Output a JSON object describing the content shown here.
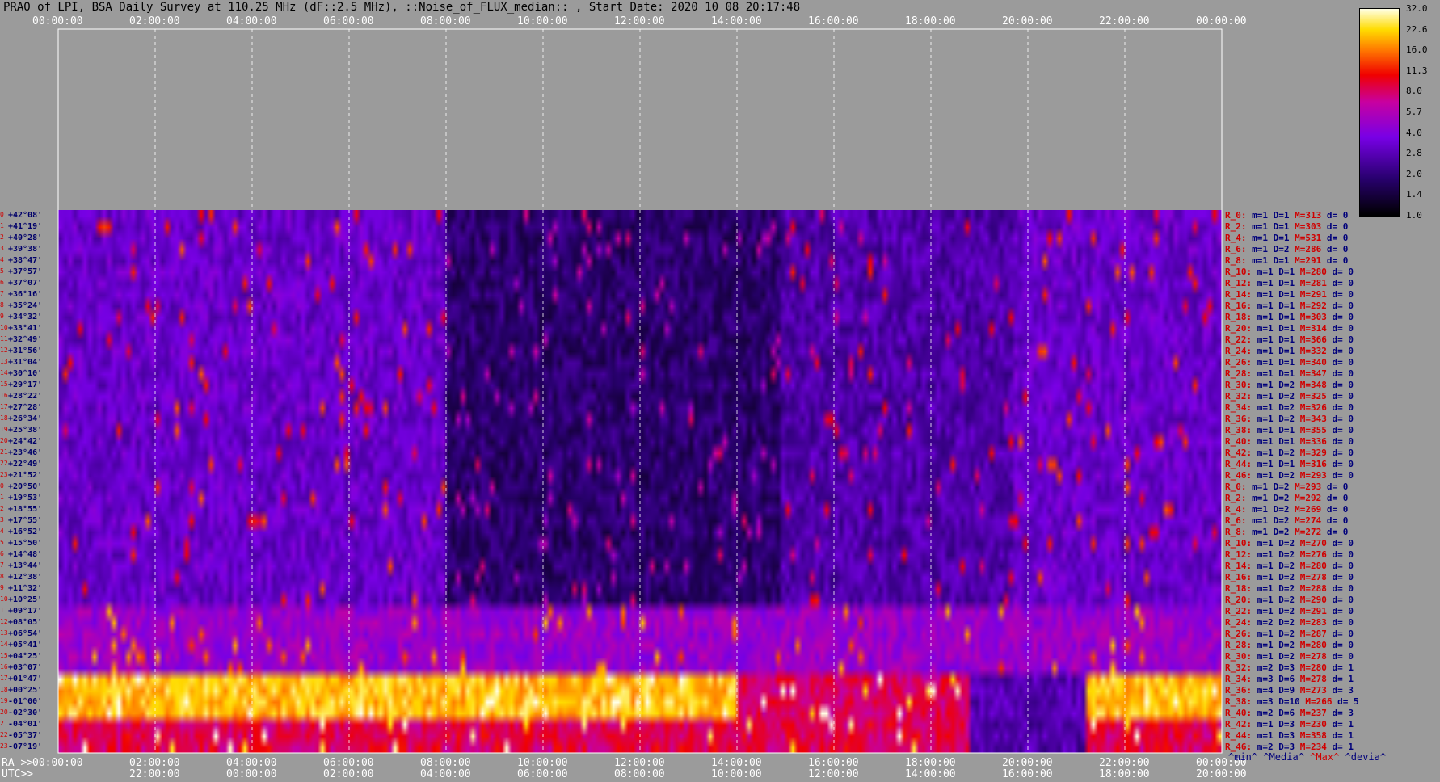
{
  "title": "PRAO of LPI, BSA Daily Survey at 110.25 MHz (dF::2.5 MHz), ::Noise_of_FLUX_median:: , Start Date: 2020 10 08 20:17:48",
  "chart_data": {
    "type": "heatmap",
    "x_top_ticks": [
      "00:00:00",
      "02:00:00",
      "04:00:00",
      "06:00:00",
      "08:00:00",
      "10:00:00",
      "12:00:00",
      "14:00:00",
      "16:00:00",
      "18:00:00",
      "20:00:00",
      "22:00:00",
      "00:00:00"
    ],
    "x_ra_ticks": [
      "00:00:00",
      "02:00:00",
      "04:00:00",
      "06:00:00",
      "08:00:00",
      "10:00:00",
      "12:00:00",
      "14:00:00",
      "16:00:00",
      "18:00:00",
      "20:00:00",
      "22:00:00",
      "00:00:00"
    ],
    "x_utc_ticks": [
      "22:00:00",
      "00:00:00",
      "02:00:00",
      "04:00:00",
      "06:00:00",
      "08:00:00",
      "10:00:00",
      "12:00:00",
      "14:00:00",
      "16:00:00",
      "18:00:00",
      "20:00:00"
    ],
    "ra_prefix": "RA >>",
    "utc_prefix": "UTC>>",
    "declinations": [
      "+42°08'",
      "+41°19'",
      "+40°28'",
      "+39°38'",
      "+38°47'",
      "+37°57'",
      "+37°07'",
      "+36°16'",
      "+35°24'",
      "+34°32'",
      "+33°41'",
      "+32°49'",
      "+31°56'",
      "+31°04'",
      "+30°10'",
      "+29°17'",
      "+28°22'",
      "+27°28'",
      "+26°34'",
      "+25°38'",
      "+24°42'",
      "+23°46'",
      "+22°49'",
      "+21°52'",
      "+20°50'",
      "+19°53'",
      "+18°55'",
      "+17°55'",
      "+16°52'",
      "+15°50'",
      "+14°48'",
      "+13°44'",
      "+12°38'",
      "+11°32'",
      "+10°25'",
      "+09°17'",
      "+08°05'",
      "+06°54'",
      "+05°41'",
      "+04°25'",
      "+03°07'",
      "+01°47'",
      "+00°25'",
      "-01°00'",
      "-02°30'",
      "-04°01'",
      "-05°37'",
      "-07°19'"
    ],
    "colorbar_ticks": [
      "32.0",
      "22.6",
      "16.0",
      "11.3",
      "8.0",
      "5.7",
      "4.0",
      "2.8",
      "2.0",
      "1.4",
      "1.0"
    ],
    "row_stats": [
      {
        "r": "R_0:",
        "m": "m=1",
        "D": "D=1",
        "M": "M=313",
        "d": "d= 0"
      },
      {
        "r": "R_2:",
        "m": "m=1",
        "D": "D=1",
        "M": "M=303",
        "d": "d= 0"
      },
      {
        "r": "R_4:",
        "m": "m=1",
        "D": "D=1",
        "M": "M=531",
        "d": "d= 0"
      },
      {
        "r": "R_6:",
        "m": "m=1",
        "D": "D=2",
        "M": "M=286",
        "d": "d= 0"
      },
      {
        "r": "R_8:",
        "m": "m=1",
        "D": "D=1",
        "M": "M=291",
        "d": "d= 0"
      },
      {
        "r": "R_10:",
        "m": "m=1",
        "D": "D=1",
        "M": "M=280",
        "d": "d= 0"
      },
      {
        "r": "R_12:",
        "m": "m=1",
        "D": "D=1",
        "M": "M=281",
        "d": "d= 0"
      },
      {
        "r": "R_14:",
        "m": "m=1",
        "D": "D=1",
        "M": "M=291",
        "d": "d= 0"
      },
      {
        "r": "R_16:",
        "m": "m=1",
        "D": "D=1",
        "M": "M=292",
        "d": "d= 0"
      },
      {
        "r": "R_18:",
        "m": "m=1",
        "D": "D=1",
        "M": "M=303",
        "d": "d= 0"
      },
      {
        "r": "R_20:",
        "m": "m=1",
        "D": "D=1",
        "M": "M=314",
        "d": "d= 0"
      },
      {
        "r": "R_22:",
        "m": "m=1",
        "D": "D=1",
        "M": "M=366",
        "d": "d= 0"
      },
      {
        "r": "R_24:",
        "m": "m=1",
        "D": "D=1",
        "M": "M=332",
        "d": "d= 0"
      },
      {
        "r": "R_26:",
        "m": "m=1",
        "D": "D=1",
        "M": "M=340",
        "d": "d= 0"
      },
      {
        "r": "R_28:",
        "m": "m=1",
        "D": "D=1",
        "M": "M=347",
        "d": "d= 0"
      },
      {
        "r": "R_30:",
        "m": "m=1",
        "D": "D=2",
        "M": "M=348",
        "d": "d= 0"
      },
      {
        "r": "R_32:",
        "m": "m=1",
        "D": "D=2",
        "M": "M=325",
        "d": "d= 0"
      },
      {
        "r": "R_34:",
        "m": "m=1",
        "D": "D=2",
        "M": "M=326",
        "d": "d= 0"
      },
      {
        "r": "R_36:",
        "m": "m=1",
        "D": "D=2",
        "M": "M=343",
        "d": "d= 0"
      },
      {
        "r": "R_38:",
        "m": "m=1",
        "D": "D=1",
        "M": "M=355",
        "d": "d= 0"
      },
      {
        "r": "R_40:",
        "m": "m=1",
        "D": "D=1",
        "M": "M=336",
        "d": "d= 0"
      },
      {
        "r": "R_42:",
        "m": "m=1",
        "D": "D=2",
        "M": "M=329",
        "d": "d= 0"
      },
      {
        "r": "R_44:",
        "m": "m=1",
        "D": "D=1",
        "M": "M=316",
        "d": "d= 0"
      },
      {
        "r": "R_46:",
        "m": "m=1",
        "D": "D=2",
        "M": "M=293",
        "d": "d= 0"
      },
      {
        "r": "R_0:",
        "m": "m=1",
        "D": "D=2",
        "M": "M=293",
        "d": "d= 0"
      },
      {
        "r": "R_2:",
        "m": "m=1",
        "D": "D=2",
        "M": "M=292",
        "d": "d= 0"
      },
      {
        "r": "R_4:",
        "m": "m=1",
        "D": "D=2",
        "M": "M=269",
        "d": "d= 0"
      },
      {
        "r": "R_6:",
        "m": "m=1",
        "D": "D=2",
        "M": "M=274",
        "d": "d= 0"
      },
      {
        "r": "R_8:",
        "m": "m=1",
        "D": "D=2",
        "M": "M=272",
        "d": "d= 0"
      },
      {
        "r": "R_10:",
        "m": "m=1",
        "D": "D=2",
        "M": "M=270",
        "d": "d= 0"
      },
      {
        "r": "R_12:",
        "m": "m=1",
        "D": "D=2",
        "M": "M=276",
        "d": "d= 0"
      },
      {
        "r": "R_14:",
        "m": "m=1",
        "D": "D=2",
        "M": "M=280",
        "d": "d= 0"
      },
      {
        "r": "R_16:",
        "m": "m=1",
        "D": "D=2",
        "M": "M=278",
        "d": "d= 0"
      },
      {
        "r": "R_18:",
        "m": "m=1",
        "D": "D=2",
        "M": "M=288",
        "d": "d= 0"
      },
      {
        "r": "R_20:",
        "m": "m=1",
        "D": "D=2",
        "M": "M=290",
        "d": "d= 0"
      },
      {
        "r": "R_22:",
        "m": "m=1",
        "D": "D=2",
        "M": "M=291",
        "d": "d= 0"
      },
      {
        "r": "R_24:",
        "m": "m=2",
        "D": "D=2",
        "M": "M=283",
        "d": "d= 0"
      },
      {
        "r": "R_26:",
        "m": "m=1",
        "D": "D=2",
        "M": "M=287",
        "d": "d= 0"
      },
      {
        "r": "R_28:",
        "m": "m=1",
        "D": "D=2",
        "M": "M=280",
        "d": "d= 0"
      },
      {
        "r": "R_30:",
        "m": "m=1",
        "D": "D=2",
        "M": "M=278",
        "d": "d= 0"
      },
      {
        "r": "R_32:",
        "m": "m=2",
        "D": "D=3",
        "M": "M=280",
        "d": "d= 1"
      },
      {
        "r": "R_34:",
        "m": "m=3",
        "D": "D=6",
        "M": "M=278",
        "d": "d= 1"
      },
      {
        "r": "R_36:",
        "m": "m=4",
        "D": "D=9",
        "M": "M=273",
        "d": "d= 3"
      },
      {
        "r": "R_38:",
        "m": "m=3",
        "D": "D=10",
        "M": "M=266",
        "d": "d= 5"
      },
      {
        "r": "R_40:",
        "m": "m=2",
        "D": "D=6",
        "M": "M=237",
        "d": "d= 3"
      },
      {
        "r": "R_42:",
        "m": "m=1",
        "D": "D=3",
        "M": "M=230",
        "d": "d= 1"
      },
      {
        "r": "R_44:",
        "m": "m=1",
        "D": "D=3",
        "M": "M=358",
        "d": "d= 1"
      },
      {
        "r": "R_46:",
        "m": "m=2",
        "D": "D=3",
        "M": "M=234",
        "d": "d= 1"
      }
    ]
  },
  "footer": {
    "min": "^min^",
    "media": "^Media^",
    "max": "^Max^",
    "devia": "^devia^"
  }
}
